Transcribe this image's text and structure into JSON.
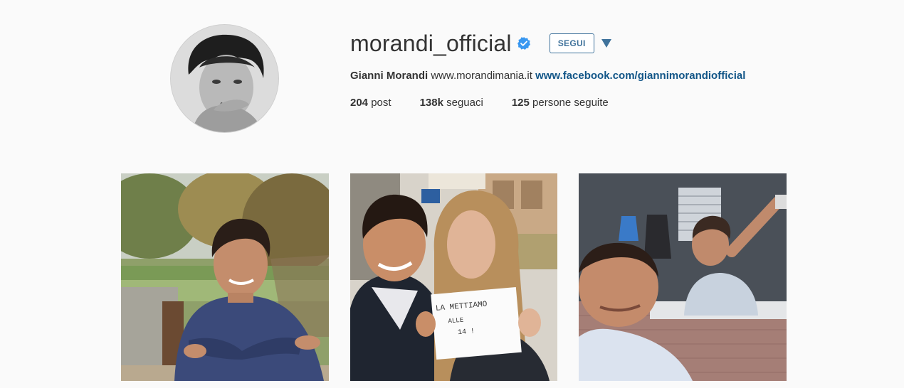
{
  "profile": {
    "username": "morandi_official",
    "full_name": "Gianni Morandi",
    "website": "www.morandimania.it",
    "facebook_link": "www.facebook.com/giannimorandiofficial",
    "follow_label": "SEGUI"
  },
  "stats": {
    "posts_count": "204",
    "posts_label": "post",
    "followers_count": "138k",
    "followers_label": "seguaci",
    "following_count": "125",
    "following_label": "persone seguite"
  },
  "photo2_note": {
    "line1": "LA METTIAMO",
    "line2": "ALLE",
    "line3": "14 !"
  },
  "colors": {
    "accent": "#3f729b",
    "link": "#125688",
    "verified": "#3897f0",
    "background": "#fafafa"
  },
  "icons": [
    "verified-badge-icon",
    "dropdown-arrow-icon"
  ]
}
